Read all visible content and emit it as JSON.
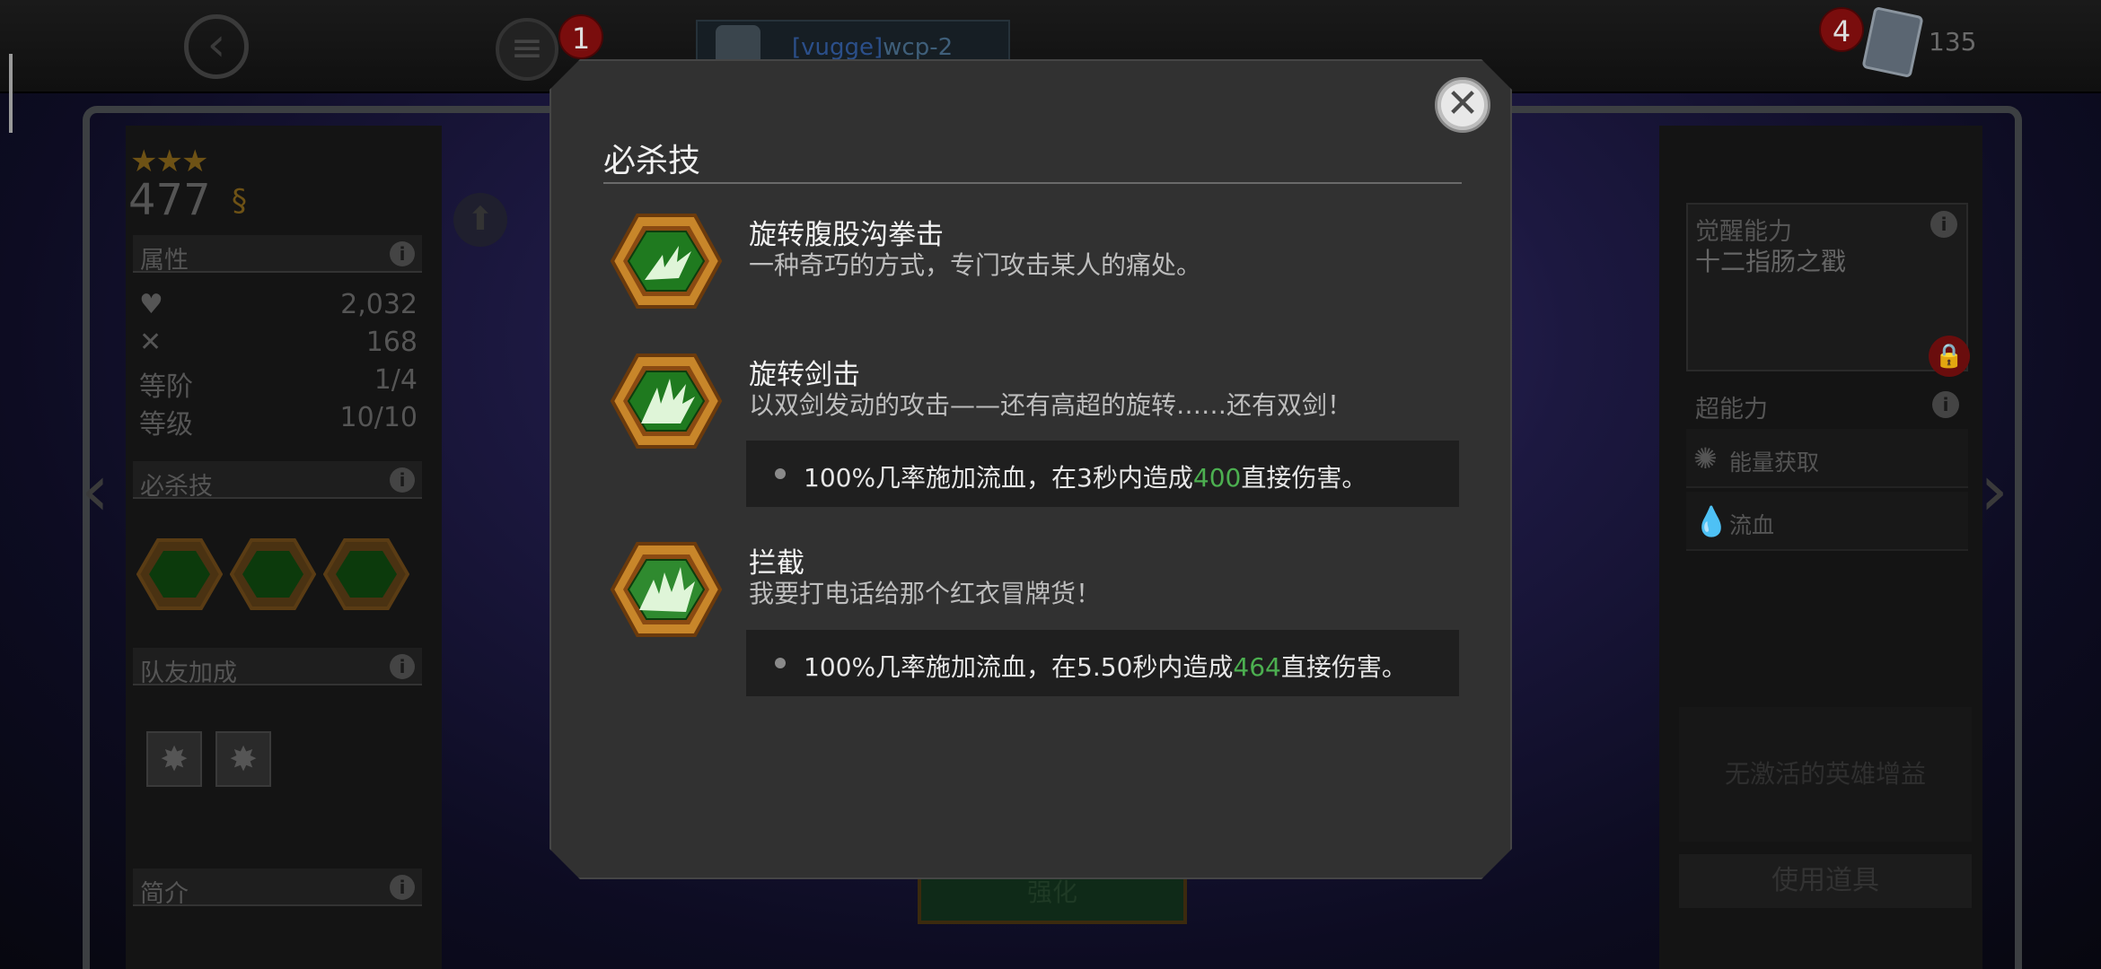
{
  "topbar": {
    "menu_badge": "1",
    "player_tag": "[vugge]",
    "player_name": "wcp-2",
    "card_badge": "4",
    "card_count": "135"
  },
  "hero": {
    "stars": "★★★",
    "rating": "477",
    "sections": {
      "attributes": "属性",
      "special": "必杀技",
      "synergy": "队友加成",
      "bio": "简介"
    },
    "stats": [
      {
        "label": "",
        "value": "2,032",
        "icon": "heart-plus-icon"
      },
      {
        "label": "",
        "value": "168",
        "icon": "crossed-swords-icon"
      },
      {
        "label": "等阶",
        "value": "1/4"
      },
      {
        "label": "等级",
        "value": "10/10"
      }
    ]
  },
  "right_panel": {
    "awakened_title": "觉醒能力",
    "awakened_name": "十二指肠之戳",
    "powers_title": "超能力",
    "powers": [
      {
        "label": "能量获取",
        "icon": "energy-burst-icon"
      },
      {
        "label": "流血",
        "icon": "blood-drop-icon"
      }
    ],
    "no_boost": "无激活的英雄增益",
    "use_item": "使用道具"
  },
  "bottom_button": "强化",
  "modal": {
    "title": "必杀技",
    "close_label": "✕",
    "abilities": [
      {
        "name": "旋转腹股沟拳击",
        "desc": "一种奇巧的方式，专门攻击某人的痛处。"
      },
      {
        "name": "旋转剑击",
        "desc": "以双剑发动的攻击——还有高超的旋转……还有双剑！",
        "effect_prefix": "100%几率施加流血，在3秒内造成",
        "effect_value": "400",
        "effect_suffix": "直接伤害。"
      },
      {
        "name": "拦截",
        "desc": "我要打电话给那个红衣冒牌货！",
        "effect_prefix": "100%几率施加流血，在5.50秒内造成",
        "effect_value": "464",
        "effect_suffix": "直接伤害。"
      }
    ]
  },
  "colors": {
    "modal_bg": "#313131",
    "effect_highlight": "#4caf50",
    "hex_gold": "#c8862a",
    "hex_green": "#1f7a1f"
  }
}
